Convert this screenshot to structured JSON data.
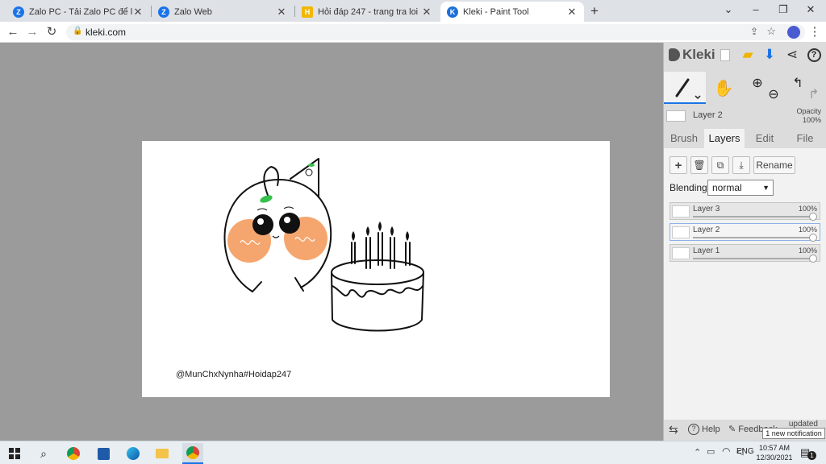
{
  "tabs": [
    {
      "title": "Zalo PC - Tải Zalo PC để làm việc",
      "favicon": "zalo-icon",
      "active": false
    },
    {
      "title": "Zalo Web",
      "favicon": "zalo-icon",
      "active": false
    },
    {
      "title": "Hỏi đáp 247 - trang tra loi",
      "favicon": "hoidap-icon",
      "active": false
    },
    {
      "title": "Kleki - Paint Tool",
      "favicon": "kleki-icon",
      "active": true
    }
  ],
  "new_tab_symbol": "+",
  "window_controls": {
    "chevron": "⌄",
    "minimize": "–",
    "restore": "❐",
    "close": "✕"
  },
  "address": {
    "url": "kleki.com"
  },
  "canvas": {
    "watermark": "@MunChxNynha#Hoidap247"
  },
  "panel": {
    "brand": "Kleki",
    "layer_name": "Layer 2",
    "opacity_label": "Opacity",
    "opacity_value": "100%",
    "tabs": [
      "Brush",
      "Layers",
      "Edit",
      "File"
    ],
    "active_tab": "Layers",
    "rename_label": "Rename",
    "blending_label": "Blending",
    "blending_value": "normal",
    "layers": [
      {
        "name": "Layer 3",
        "opacity": "100%",
        "selected": false
      },
      {
        "name": "Layer 2",
        "opacity": "100%",
        "selected": true
      },
      {
        "name": "Layer 1",
        "opacity": "100%",
        "selected": false
      }
    ],
    "footer": {
      "help": "Help",
      "feedback": "Feedback",
      "updated": "updated",
      "notification": "1 new notification"
    }
  },
  "taskbar": {
    "language": "ENG",
    "time": "10:57 AM",
    "date": "12/30/2021",
    "notification_count": "1"
  },
  "colors": {
    "accent": "#1a73e8",
    "kleki_blue": "#1e6fd9",
    "cheek": "#f5a66f",
    "sprout": "#36c04d"
  }
}
